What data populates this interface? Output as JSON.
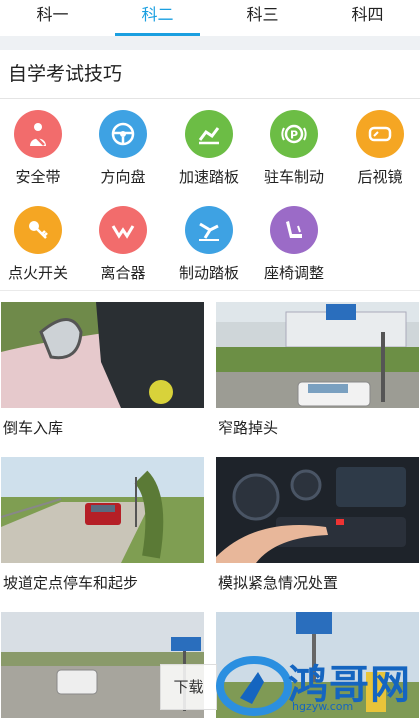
{
  "tabs": [
    "科一",
    "科二",
    "科三",
    "科四"
  ],
  "active_tab": "科二",
  "section_title": "自学考试技巧",
  "icons": [
    {
      "label": "安全带",
      "icon": "seatbelt-icon",
      "color": "#f26c6c"
    },
    {
      "label": "方向盘",
      "icon": "steering-wheel-icon",
      "color": "#3ea2e3"
    },
    {
      "label": "加速踏板",
      "icon": "accelerator-pedal-icon",
      "color": "#6cbd45"
    },
    {
      "label": "驻车制动",
      "icon": "parking-brake-icon",
      "color": "#6cbd45"
    },
    {
      "label": "后视镜",
      "icon": "mirror-icon",
      "color": "#f5a623"
    },
    {
      "label": "点火开关",
      "icon": "key-icon",
      "color": "#f5a623"
    },
    {
      "label": "离合器",
      "icon": "clutch-icon",
      "color": "#f26c6c"
    },
    {
      "label": "制动踏板",
      "icon": "brake-pedal-icon",
      "color": "#3ea2e3"
    },
    {
      "label": "座椅调整",
      "icon": "seat-icon",
      "color": "#9b6bc7"
    }
  ],
  "cards": [
    {
      "caption": "倒车入库"
    },
    {
      "caption": "窄路掉头"
    },
    {
      "caption": "坡道定点停车和起步"
    },
    {
      "caption": "模拟紧急情况处置"
    },
    {
      "caption": ""
    },
    {
      "caption": ""
    }
  ],
  "download_label": "下载",
  "watermark": {
    "text": "鸿哥网",
    "sub": "hgzyw.com",
    "color": "#1565c0"
  }
}
